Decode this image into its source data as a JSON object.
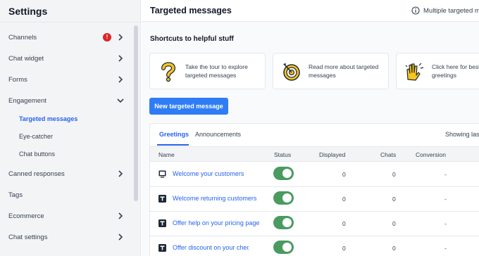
{
  "sidebar": {
    "title": "Settings",
    "badge": "!",
    "items": [
      {
        "label": "Channels"
      },
      {
        "label": "Chat widget"
      },
      {
        "label": "Forms"
      },
      {
        "label": "Engagement"
      },
      {
        "label": "Targeted messages"
      },
      {
        "label": "Eye-catcher"
      },
      {
        "label": "Chat buttons"
      },
      {
        "label": "Canned responses"
      },
      {
        "label": "Tags"
      },
      {
        "label": "Ecommerce"
      },
      {
        "label": "Chat settings"
      }
    ]
  },
  "header": {
    "title": "Targeted messages",
    "multi_label": "Multiple targeted m"
  },
  "shortcuts": {
    "title": "Shortcuts to helpful stuff",
    "cards": [
      {
        "text": "Take the tour to explore targeted messages",
        "icon": "question-mark-icon"
      },
      {
        "text": "Read more about targeted messages",
        "icon": "target-icon"
      },
      {
        "text": "Click here for best for greetings",
        "icon": "waving-hands-icon"
      }
    ]
  },
  "new_button": "New targeted message",
  "tabs": [
    {
      "label": "Greetings",
      "active": true
    },
    {
      "label": "Announcements",
      "active": false
    }
  ],
  "showing_label": "Showing las",
  "table": {
    "columns": [
      "Name",
      "Status",
      "Displayed",
      "Chats",
      "Conversion"
    ],
    "rows": [
      {
        "icon": "monitor-icon",
        "name": "Welcome your customers",
        "status": "on",
        "displayed": "0",
        "chats": "0",
        "conversion": "-"
      },
      {
        "icon": "text-icon",
        "name": "Welcome returning customers",
        "status": "on",
        "displayed": "0",
        "chats": "0",
        "conversion": "-"
      },
      {
        "icon": "text-icon",
        "name": "Offer help on your pricing page",
        "status": "on",
        "displayed": "0",
        "chats": "0",
        "conversion": "-"
      },
      {
        "icon": "text-icon",
        "name": "Offer discount on your checkout pa",
        "status": "on",
        "displayed": "0",
        "chats": "0",
        "conversion": "-"
      }
    ]
  },
  "colors": {
    "accent": "#2f7df6",
    "link": "#2563eb",
    "toggle_on": "#4a9b60",
    "badge": "#dc2626"
  }
}
